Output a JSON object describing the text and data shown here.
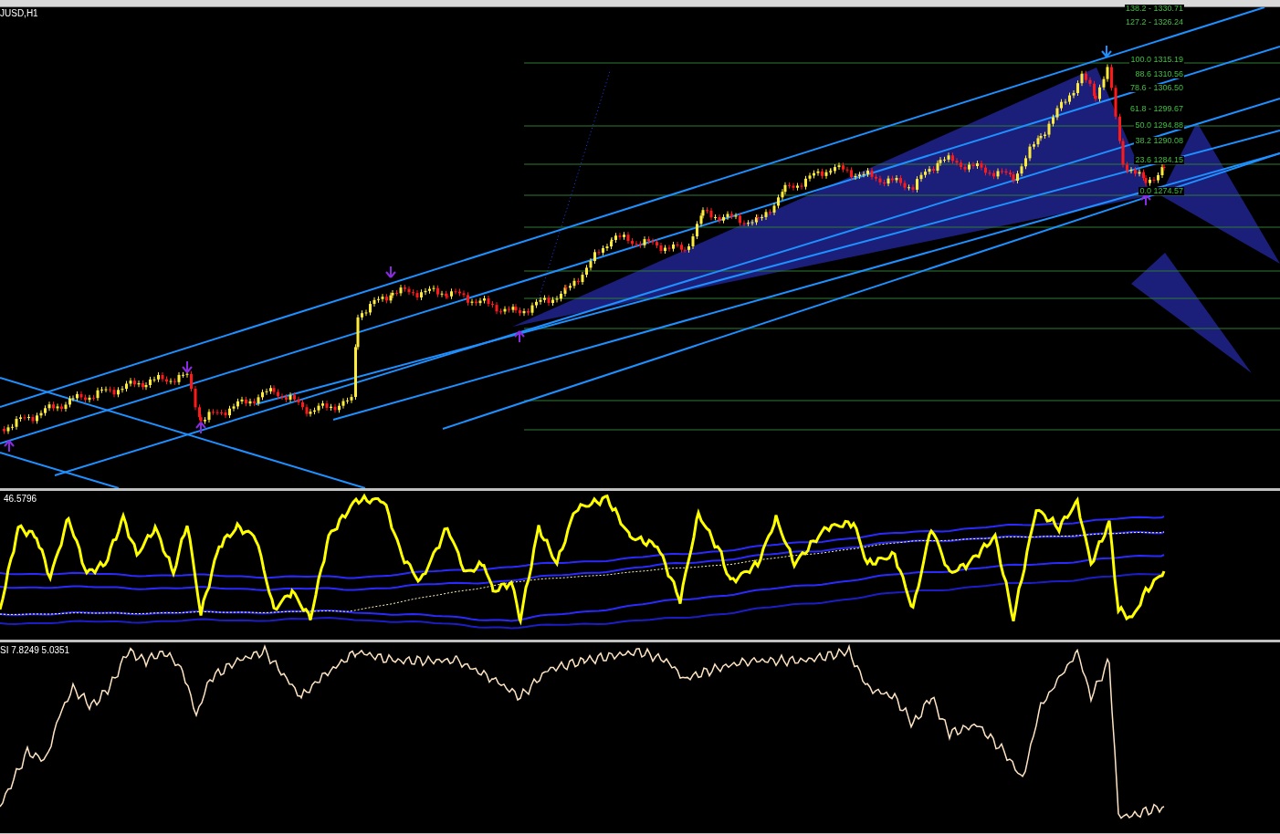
{
  "chart": {
    "symbol_label": "JUSD,H1",
    "fib_levels": [
      {
        "label": "138.2 - 1330.71"
      },
      {
        "label": "127.2 - 1326.24"
      },
      {
        "label": "100.0 1315.19"
      },
      {
        "label": "88.6 1310.56"
      },
      {
        "label": "78.6 - 1306.50"
      },
      {
        "label": "61.8 - 1299.67"
      },
      {
        "label": "50.0 1294.88"
      },
      {
        "label": "38.2 1290.08"
      },
      {
        "label": "23.6 1284.15"
      },
      {
        "label": "0.0 1274.57"
      }
    ]
  },
  "indicators": [
    {
      "label": "46.5796"
    },
    {
      "label": "SI 7.8249 5.0351"
    }
  ]
}
